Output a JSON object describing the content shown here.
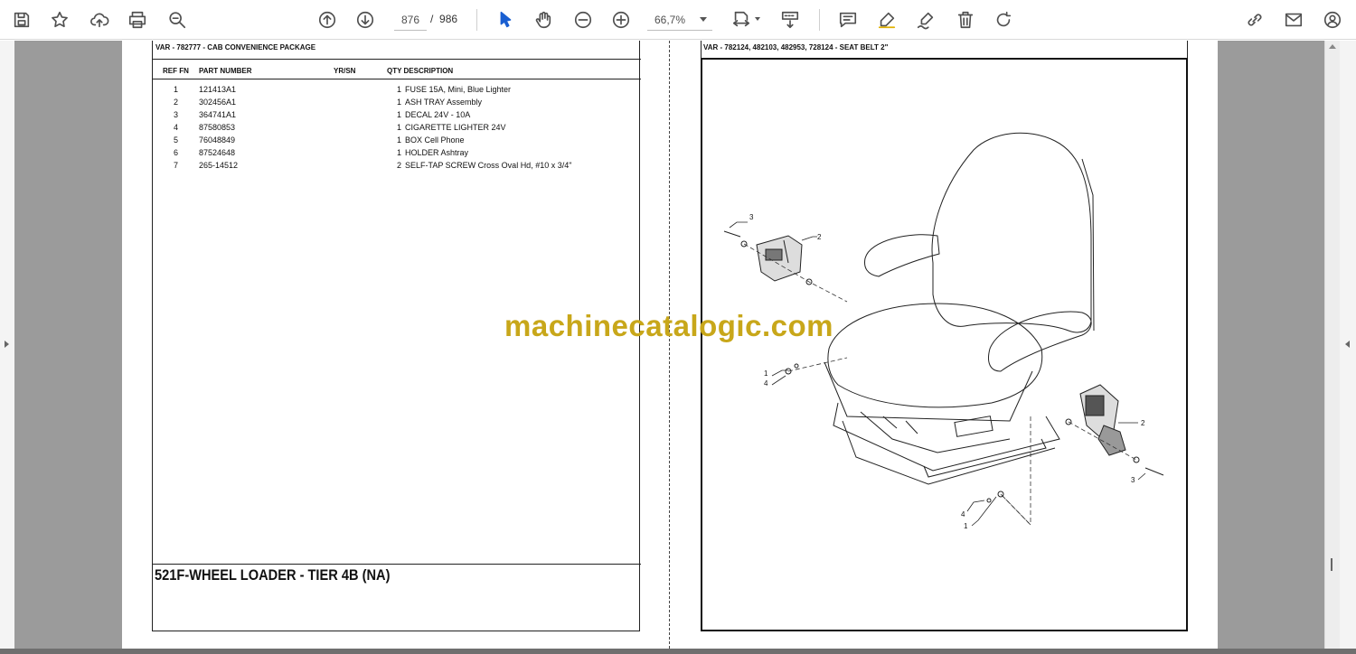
{
  "toolbar": {
    "current_page": "876",
    "page_separator": "/",
    "total_pages": "986",
    "zoom": "66,7%"
  },
  "left_page": {
    "header": "VAR - 782777 - CAB CONVENIENCE PACKAGE",
    "columns": {
      "ref_fn": "REF  FN",
      "part_number": "PART NUMBER",
      "yr_sn": "YR/SN",
      "qty_description": "QTY  DESCRIPTION"
    },
    "rows": [
      {
        "ref": "1",
        "part": "121413A1",
        "qty": "1",
        "desc": "FUSE 15A, Mini, Blue Lighter"
      },
      {
        "ref": "2",
        "part": "302456A1",
        "qty": "1",
        "desc": "ASH TRAY  Assembly"
      },
      {
        "ref": "3",
        "part": "364741A1",
        "qty": "1",
        "desc": "DECAL  24V - 10A"
      },
      {
        "ref": "4",
        "part": "87580853",
        "qty": "1",
        "desc": "CIGARETTE LIGHTER  24V"
      },
      {
        "ref": "5",
        "part": "76048849",
        "qty": "1",
        "desc": "BOX  Cell Phone"
      },
      {
        "ref": "6",
        "part": "87524648",
        "qty": "1",
        "desc": "HOLDER  Ashtray"
      },
      {
        "ref": "7",
        "part": "265-14512",
        "qty": "2",
        "desc": "SELF-TAP SCREW Cross Oval Hd, #10 x 3/4\""
      }
    ],
    "footer_title": "521F-WHEEL LOADER - TIER 4B (NA)"
  },
  "right_page": {
    "header": "VAR - 782124, 482103, 482953, 728124 - SEAT BELT 2\"",
    "callouts": [
      "3",
      "2",
      "1",
      "4",
      "2",
      "3",
      "4",
      "1"
    ]
  },
  "watermark": "machinecatalogic.com",
  "colors": {
    "viewer_background": "#9b9b9b",
    "watermark": "#c8a71a",
    "icon": "#505050"
  }
}
